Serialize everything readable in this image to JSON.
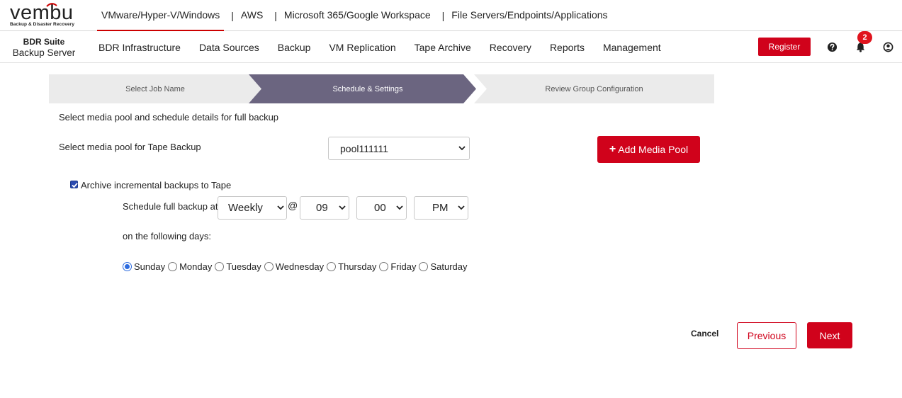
{
  "brand": {
    "logo_text": "vembu",
    "logo_tagline": "Backup & Disaster Recovery",
    "suite": "BDR Suite",
    "server": "Backup Server"
  },
  "product_tabs": [
    {
      "label": "VMware/Hyper-V/Windows",
      "active": true
    },
    {
      "label": "AWS"
    },
    {
      "label": "Microsoft 365/Google Workspace"
    },
    {
      "label": "File Servers/Endpoints/Applications"
    }
  ],
  "tab_separator": "|",
  "menu": [
    "BDR Infrastructure",
    "Data Sources",
    "Backup",
    "VM Replication",
    "Tape Archive",
    "Recovery",
    "Reports",
    "Management"
  ],
  "header_actions": {
    "register_label": "Register",
    "notification_count": "2"
  },
  "wizard": {
    "steps": [
      "Select Job Name",
      "Schedule & Settings",
      "Review Group Configuration"
    ],
    "active_step": 1
  },
  "form": {
    "intro": "Select media pool and schedule details for full backup",
    "media_pool_label": "Select media pool for Tape Backup",
    "media_pool_value": "pool111111",
    "add_media_pool_label": "Add Media Pool",
    "archive_incremental_label": "Archive incremental backups to Tape",
    "archive_incremental_checked": true,
    "schedule_label": "Schedule full backup at",
    "frequency": "Weekly",
    "at_symbol": "@",
    "hour": "09",
    "minute": "00",
    "ampm": "PM",
    "days_label": "on the following days:",
    "days": [
      "Sunday",
      "Monday",
      "Tuesday",
      "Wednesday",
      "Thursday",
      "Friday",
      "Saturday"
    ],
    "selected_day": "Sunday"
  },
  "footer": {
    "cancel_label": "Cancel",
    "previous_label": "Previous",
    "next_label": "Next"
  },
  "colors": {
    "accent": "#d0021b",
    "active_step": "#6b6580",
    "inactive_step": "#ebebeb",
    "radio_selected": "#2d6cdf"
  }
}
